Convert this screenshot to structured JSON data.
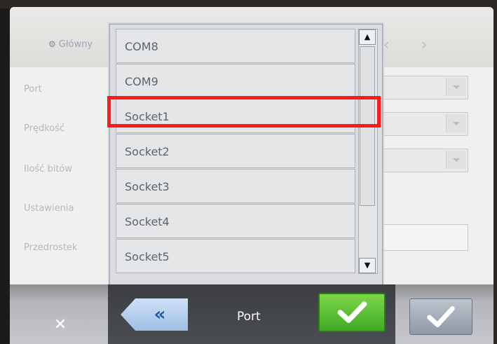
{
  "header": {
    "title": "Główny",
    "prev_arrow": "‹",
    "next_arrow": "›"
  },
  "settings_labels": [
    "Port",
    "Prędkość",
    "Ilość bitów",
    "Ustawienia",
    "Przedrostek"
  ],
  "dropdown": {
    "items": [
      "COM8",
      "COM9",
      "Socket1",
      "Socket2",
      "Socket3",
      "Socket4",
      "Socket5"
    ],
    "highlighted": "Socket1",
    "scroll_up": "▲",
    "scroll_down": "▼"
  },
  "bottom_bar": {
    "close_label": "✕",
    "back_label": "«",
    "title": "Port"
  },
  "colors": {
    "highlight": "#ff1a1a",
    "confirm_green": "#3faa25",
    "back_blue": "#9fc0e6"
  }
}
